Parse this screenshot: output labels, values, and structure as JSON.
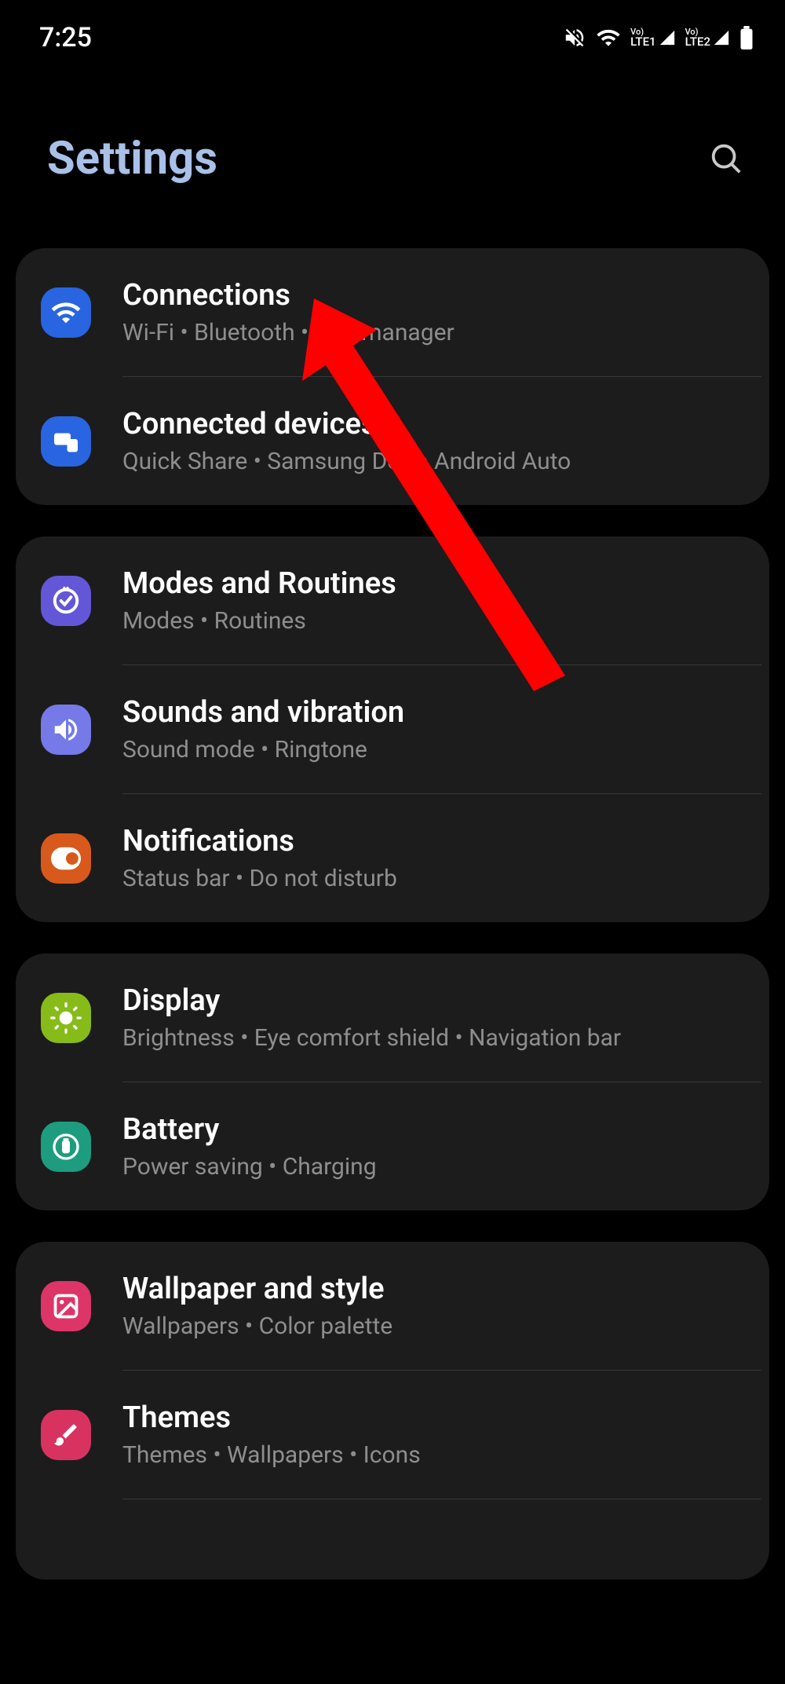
{
  "status_bar": {
    "time": "7:25",
    "lte1": "LTE1",
    "lte2": "LTE2"
  },
  "header": {
    "title": "Settings"
  },
  "groups": [
    {
      "items": [
        {
          "icon": "wifi-icon",
          "icon_color": "icon-blue",
          "title": "Connections",
          "subtitle": "Wi-Fi  •  Bluetooth  •  SIM manager"
        },
        {
          "icon": "devices-icon",
          "icon_color": "icon-blue",
          "title": "Connected devices",
          "subtitle": "Quick Share  •  Samsung DeX  •  Android Auto"
        }
      ]
    },
    {
      "items": [
        {
          "icon": "routines-icon",
          "icon_color": "icon-purple",
          "title": "Modes and Routines",
          "subtitle": "Modes  •  Routines"
        },
        {
          "icon": "sound-icon",
          "icon_color": "icon-lightpurple",
          "title": "Sounds and vibration",
          "subtitle": "Sound mode  •  Ringtone"
        },
        {
          "icon": "notifications-icon",
          "icon_color": "icon-orange",
          "title": "Notifications",
          "subtitle": "Status bar  •  Do not disturb"
        }
      ]
    },
    {
      "items": [
        {
          "icon": "display-icon",
          "icon_color": "icon-green",
          "title": "Display",
          "subtitle": "Brightness  •  Eye comfort shield  •  Navigation bar"
        },
        {
          "icon": "battery-icon",
          "icon_color": "icon-teal",
          "title": "Battery",
          "subtitle": "Power saving  •  Charging"
        }
      ]
    },
    {
      "items": [
        {
          "icon": "wallpaper-icon",
          "icon_color": "icon-pink",
          "title": "Wallpaper and style",
          "subtitle": "Wallpapers  •  Color palette"
        },
        {
          "icon": "themes-icon",
          "icon_color": "icon-magenta",
          "title": "Themes",
          "subtitle": "Themes  •  Wallpapers  •  Icons"
        }
      ]
    }
  ]
}
